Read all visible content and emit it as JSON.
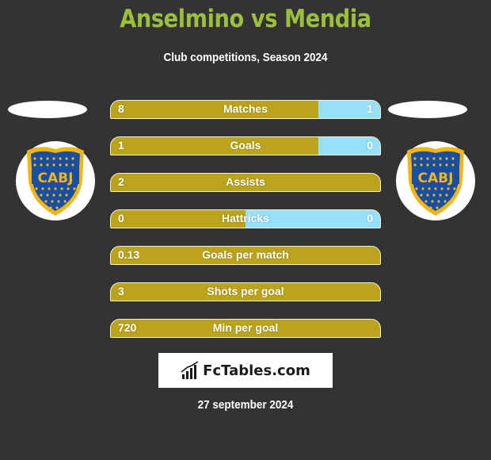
{
  "header": {
    "title": "Anselmino vs Mendia",
    "subtitle": "Club competitions, Season 2024"
  },
  "players": {
    "left": {
      "name": "Anselmino",
      "club_badge": "CABJ",
      "badge_icon": "boca-juniors-crest-icon"
    },
    "right": {
      "name": "Mendia",
      "club_badge": "CABJ",
      "badge_icon": "boca-juniors-crest-icon"
    }
  },
  "colors": {
    "title": "#9bbf3b",
    "left_bar": "#bba31b",
    "right_bar": "#96e0fa",
    "background": "#333333"
  },
  "stats": [
    {
      "label": "Matches",
      "left": "8",
      "right": "1",
      "right_share": 0.23
    },
    {
      "label": "Goals",
      "left": "1",
      "right": "0",
      "right_share": 0.23
    },
    {
      "label": "Assists",
      "left": "2",
      "right": "",
      "right_share": 0
    },
    {
      "label": "Hattricks",
      "left": "0",
      "right": "0",
      "right_share": 0.5
    },
    {
      "label": "Goals per match",
      "left": "0.13",
      "right": "",
      "right_share": 0
    },
    {
      "label": "Shots per goal",
      "left": "3",
      "right": "",
      "right_share": 0
    },
    {
      "label": "Min per goal",
      "left": "720",
      "right": "",
      "right_share": 0
    }
  ],
  "footer": {
    "logo_text": "FcTables.com",
    "logo_icon": "bar-chart-icon",
    "date": "27 september 2024"
  }
}
